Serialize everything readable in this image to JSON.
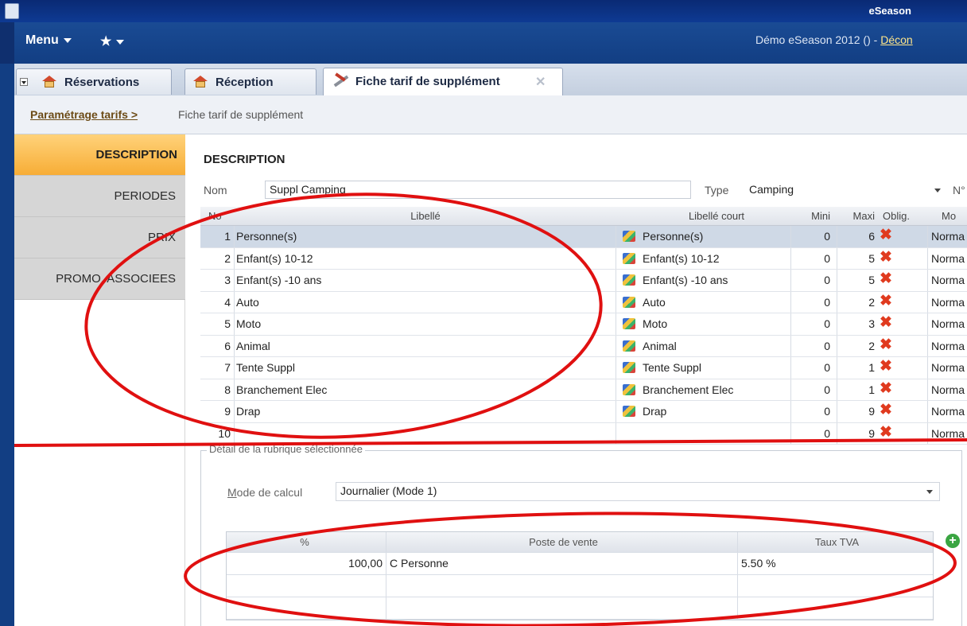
{
  "window": {
    "title": "eSeason"
  },
  "menubar": {
    "menu_label": "Menu",
    "favorites_icon": "star-icon",
    "user_text": "Démo eSeason 2012 () - ",
    "logout_link": "Décon"
  },
  "tabs": [
    {
      "label": "Réservations",
      "icon": "house-icon"
    },
    {
      "label": "Réception",
      "icon": "house-icon"
    },
    {
      "label": "Fiche tarif de supplément",
      "icon": "tools-icon",
      "active": true
    }
  ],
  "breadcrumb": {
    "parent": "Paramétrage tarifs >",
    "current": "Fiche tarif de supplément"
  },
  "sidenav": {
    "items": [
      "DESCRIPTION",
      "PERIODES",
      "PRIX",
      "PROMO. ASSOCIEES"
    ],
    "active_index": 0
  },
  "description": {
    "section_title": "DESCRIPTION",
    "nom_label": "Nom",
    "nom_value": "Suppl Camping",
    "type_label": "Type",
    "type_value": "Camping",
    "num_label": "N°"
  },
  "grid": {
    "headers": {
      "no": "No",
      "libelle": "Libellé",
      "libelle_court": "Libellé court",
      "mini": "Mini",
      "maxi": "Maxi",
      "oblig": "Oblig.",
      "mode": "Mo"
    },
    "rows": [
      {
        "no": "1",
        "libelle": "Personne(s)",
        "court": "Personne(s)",
        "mini": "0",
        "maxi": "6",
        "mode": "Norma"
      },
      {
        "no": "2",
        "libelle": "Enfant(s) 10-12",
        "court": "Enfant(s) 10-12",
        "mini": "0",
        "maxi": "5",
        "mode": "Norma"
      },
      {
        "no": "3",
        "libelle": "Enfant(s) -10 ans",
        "court": "Enfant(s) -10 ans",
        "mini": "0",
        "maxi": "5",
        "mode": "Norma"
      },
      {
        "no": "4",
        "libelle": "Auto",
        "court": "Auto",
        "mini": "0",
        "maxi": "2",
        "mode": "Norma"
      },
      {
        "no": "5",
        "libelle": "Moto",
        "court": "Moto",
        "mini": "0",
        "maxi": "3",
        "mode": "Norma"
      },
      {
        "no": "6",
        "libelle": "Animal",
        "court": "Animal",
        "mini": "0",
        "maxi": "2",
        "mode": "Norma"
      },
      {
        "no": "7",
        "libelle": "Tente Suppl",
        "court": "Tente Suppl",
        "mini": "0",
        "maxi": "1",
        "mode": "Norma"
      },
      {
        "no": "8",
        "libelle": "Branchement Elec",
        "court": "Branchement Elec",
        "mini": "0",
        "maxi": "1",
        "mode": "Norma"
      },
      {
        "no": "9",
        "libelle": "Drap",
        "court": "Drap",
        "mini": "0",
        "maxi": "9",
        "mode": "Norma"
      },
      {
        "no": "10",
        "libelle": "",
        "court": "",
        "mini": "0",
        "maxi": "9",
        "mode": "Norma"
      }
    ],
    "selected_index": 0
  },
  "detail": {
    "legend": "Détail de la rubrique sélectionnée",
    "mode_label": "Mode de calcul",
    "mode_value": "Journalier (Mode 1)",
    "table": {
      "headers": {
        "pct": "%",
        "poste": "Poste de vente",
        "tva": "Taux TVA"
      },
      "rows": [
        {
          "pct": "100,00",
          "poste": "C Personne",
          "tva": "5.50 %"
        },
        {
          "pct": "",
          "poste": "",
          "tva": ""
        },
        {
          "pct": "",
          "poste": "",
          "tva": ""
        }
      ]
    }
  },
  "colors": {
    "accent_blue": "#123e83",
    "active_nav": "#f7ad36",
    "annotation_red": "#e01010"
  }
}
